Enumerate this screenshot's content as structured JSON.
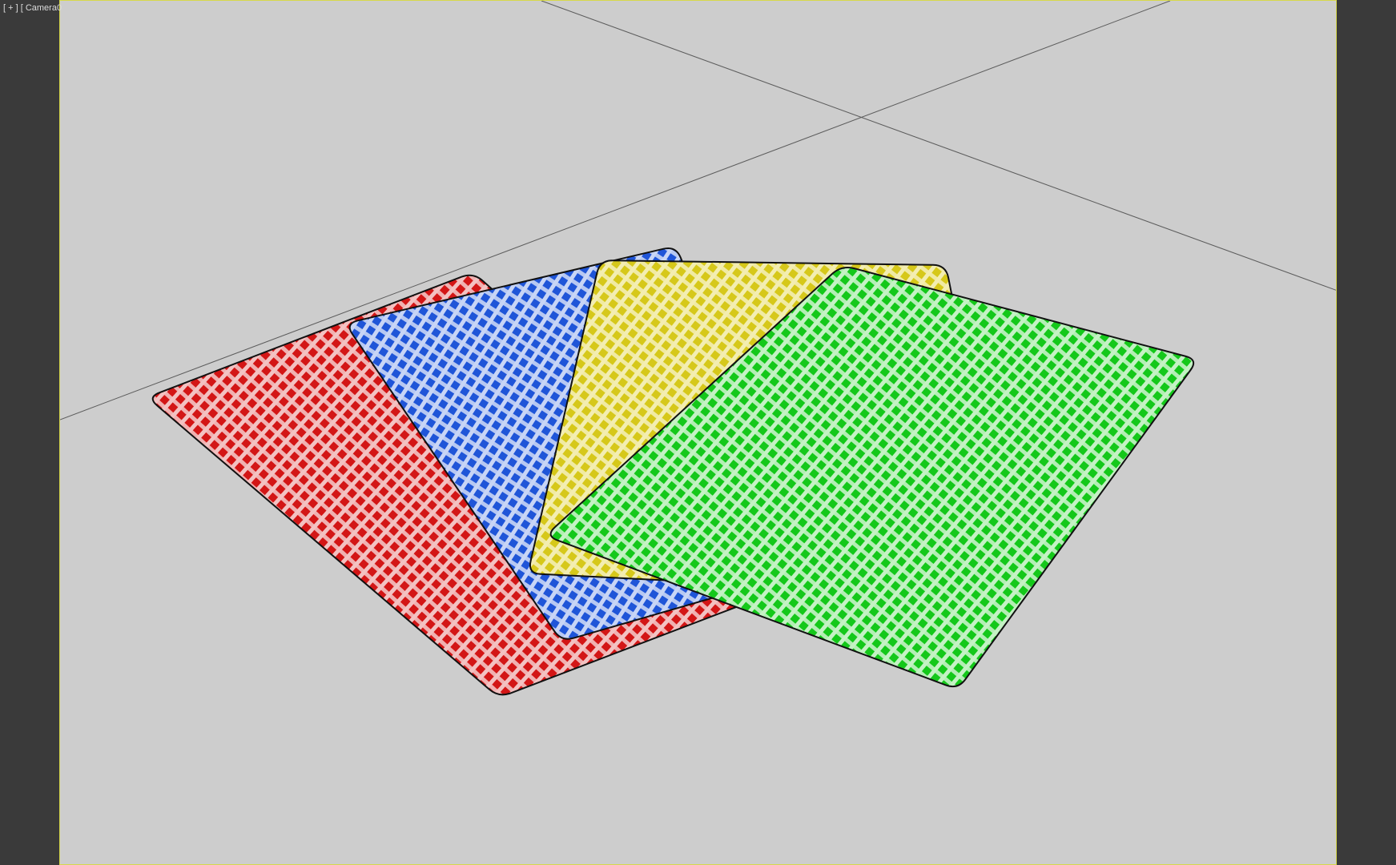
{
  "viewport": {
    "label_menu": "[ + ]",
    "label_camera": "[ Camera0"
  },
  "scene": {
    "background_color": "#cdcdcd",
    "frame_color": "#d7d84a",
    "grid_color": "#5c5c5c",
    "cards": [
      {
        "name": "red-card",
        "color": "#d31616",
        "light": "#f3c2c2"
      },
      {
        "name": "blue-card",
        "color": "#1f55d8",
        "light": "#c8d5f6"
      },
      {
        "name": "yellow-card",
        "color": "#d6c81a",
        "light": "#f3eeb2"
      },
      {
        "name": "green-card",
        "color": "#14c81a",
        "light": "#c5f2c5"
      }
    ]
  }
}
